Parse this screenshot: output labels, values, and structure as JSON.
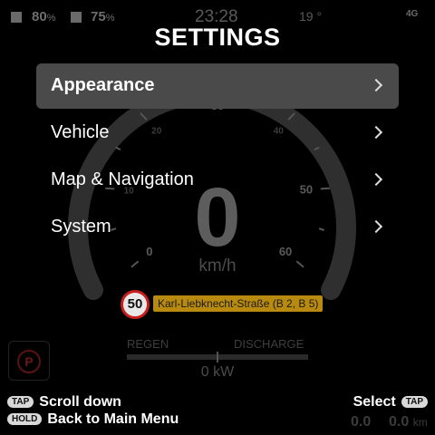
{
  "status": {
    "battery1": "80",
    "battery2": "75",
    "percent": "%",
    "clock": "23:28",
    "temp": "19 °",
    "network": "4G"
  },
  "dashboard": {
    "speed": "0",
    "unit": "km/h",
    "gauge_ticks": [
      "0",
      "10",
      "20",
      "30",
      "40",
      "50",
      "60"
    ],
    "speed_limit": "50",
    "street": "Karl-Liebknecht-Straße (B 2, B 5)",
    "regen_label": "REGEN",
    "discharge_label": "DISCHARGE",
    "power": "0 kW",
    "park_symbol": "P",
    "trip1": "0.0",
    "trip2": "0.0",
    "trip2_unit": "km"
  },
  "settings": {
    "title": "SETTINGS",
    "items": [
      {
        "label": "Appearance",
        "selected": true
      },
      {
        "label": "Vehicle",
        "selected": false
      },
      {
        "label": "Map & Navigation",
        "selected": false
      },
      {
        "label": "System",
        "selected": false
      }
    ]
  },
  "hints": {
    "tap_pill": "TAP",
    "hold_pill": "HOLD",
    "scroll_down": "Scroll down",
    "back": "Back to Main Menu",
    "select": "Select"
  }
}
